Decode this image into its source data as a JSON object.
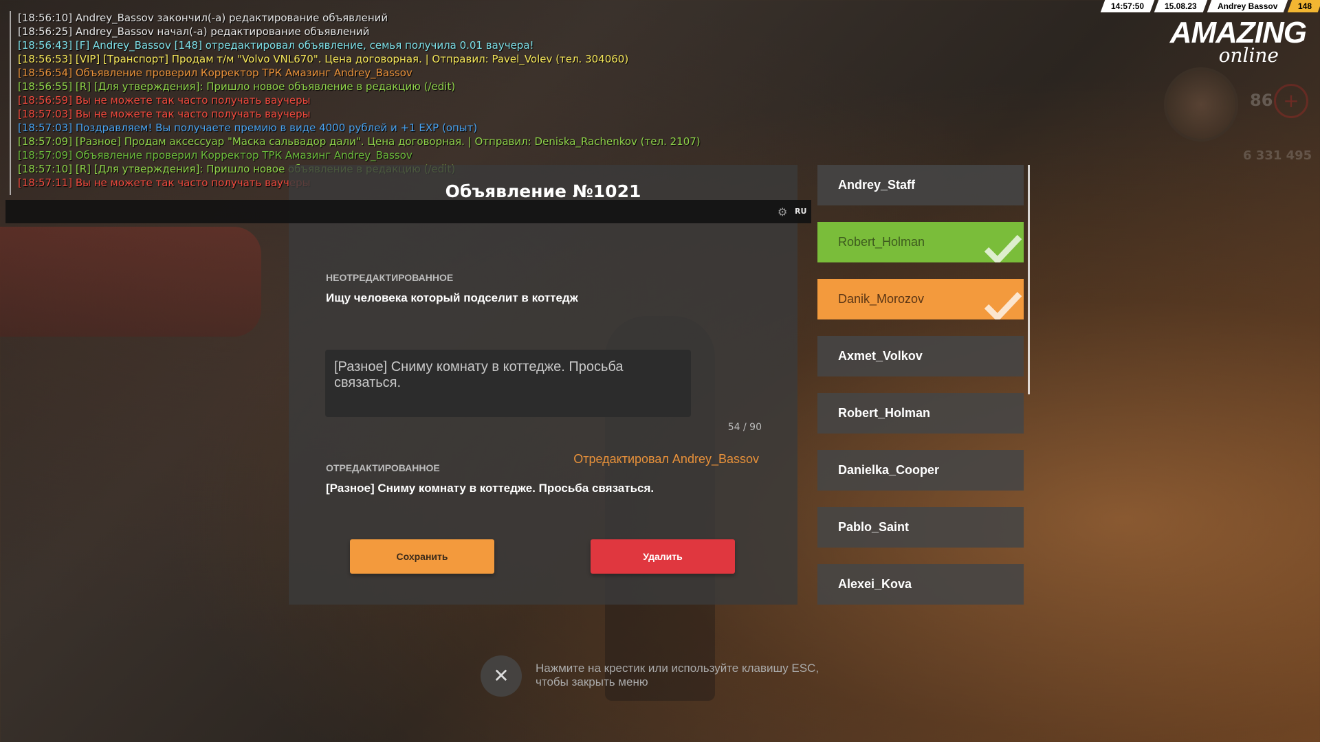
{
  "chat": [
    {
      "text": "[18:56:10] Andrey_Bassov закончил(-а) редактирование объявлений",
      "color": "#e6e6e6"
    },
    {
      "text": "[18:56:25] Andrey_Bassov начал(-а) редактирование объявлений",
      "color": "#e6e6e6"
    },
    {
      "text": "[18:56:43] [F] Andrey_Bassov [148] отредактировал объявление, семья получила 0.01 ваучера!",
      "color": "#7ee0e8"
    },
    {
      "text": "[18:56:53] [VIP] [Транспорт] Продам т/м \"Volvo VNL670\". Цена договорная. | Отправил: Pavel_Volev (тел. 304060)",
      "color": "#f5e65a"
    },
    {
      "text": "[18:56:54] Объявление проверил Корректор ТРК Амазинг Andrey_Bassov",
      "color": "#e8913a"
    },
    {
      "text": "[18:56:55] [R] [Для утверждения]: Пришло новое объявление в редакцию (/edit)",
      "color": "#8fd34a"
    },
    {
      "text": "[18:56:59] Вы не можете так часто получать ваучеры",
      "color": "#ef4a3e"
    },
    {
      "text": "[18:57:03] Вы не можете так часто получать ваучеры",
      "color": "#ef4a3e"
    },
    {
      "text": "[18:57:03] Поздравляем! Вы получаете премию в виде 4000 рублей и +1 EXP (опыт)",
      "color": "#4aa3f0"
    },
    {
      "text": "[18:57:09] [Разное] Продам аксессуар \"Маска сальвадор дали\". Цена договорная. | Отправил: Deniska_Rachenkov (тел. 2107)",
      "color": "#8fd34a"
    },
    {
      "text": "[18:57:09] Объявление проверил Корректор ТРК Амазинг Andrey_Bassov",
      "color": "#6cbb3c"
    },
    {
      "text": "[18:57:10] [R] [Для утверждения]: Пришло новое объявление в редакцию (/edit)",
      "color": "#8fd34a"
    },
    {
      "text": "[18:57:11] Вы не можете так часто получать ваучеры",
      "color": "#ef4a3e"
    }
  ],
  "status": {
    "time": "14:57:50",
    "date": "15.08.23",
    "player": "Andrey Bassov",
    "id": "148"
  },
  "logo": {
    "main": "AMAZING",
    "sub": "online"
  },
  "hud": {
    "health": "86",
    "money": "6 331 495"
  },
  "input": {
    "lang": "RU"
  },
  "dialog": {
    "title": "Объявление №1021",
    "unedited_label": "НЕОТРЕДАКТИРОВАННОЕ",
    "unedited_text": "Ищу человека который подселит в коттедж",
    "input_value": "[Разное] Сниму комнату в коттедже. Просьба связаться.",
    "counter": "54 / 90",
    "edited_label": "ОТРЕДАКТИРОВАННОЕ",
    "edited_by": "Отредактировал Andrey_Bassov",
    "edited_text": "[Разное] Сниму комнату в коттедже. Просьба связаться.",
    "save_label": "Сохранить",
    "delete_label": "Удалить"
  },
  "editors": [
    {
      "name": "Andrey_Staff",
      "state": "none"
    },
    {
      "name": "Robert_Holman",
      "state": "green"
    },
    {
      "name": "Danik_Morozov",
      "state": "orange"
    },
    {
      "name": "Axmet_Volkov",
      "state": "none"
    },
    {
      "name": "Robert_Holman",
      "state": "none"
    },
    {
      "name": "Danielka_Cooper",
      "state": "none"
    },
    {
      "name": "Pablo_Saint",
      "state": "none"
    },
    {
      "name": "Alexei_Kova",
      "state": "none"
    }
  ],
  "close_hint": {
    "line1": "Нажмите на крестик или используйте клавишу ESC,",
    "line2": "чтобы закрыть меню"
  },
  "icons": {
    "close": "close-icon",
    "check": "check-icon",
    "gear": "gear-icon"
  }
}
